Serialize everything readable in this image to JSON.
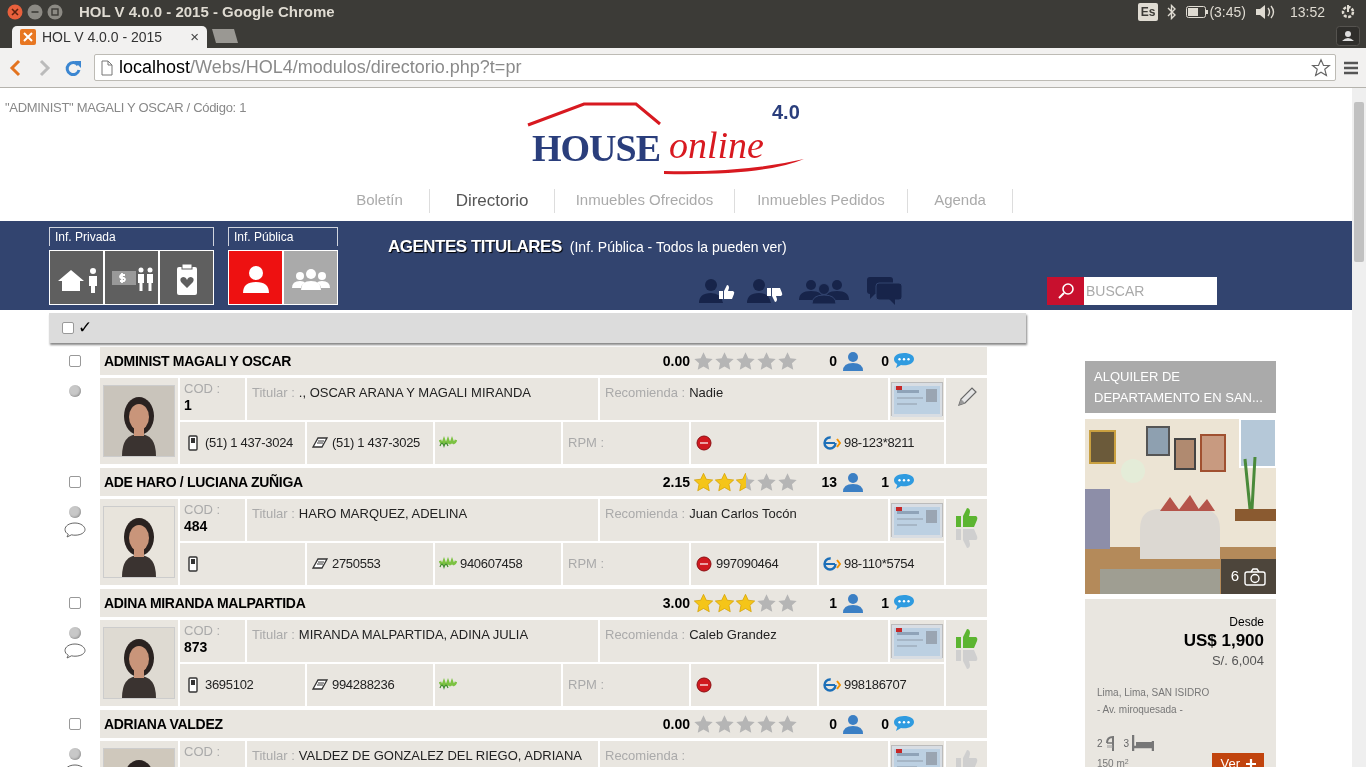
{
  "window": {
    "title": "HOL V 4.0.0 - 2015 - Google Chrome"
  },
  "tray": {
    "keyboard": "Es",
    "battery": "(3:45)",
    "clock": "13:52"
  },
  "tabs": [
    {
      "label": "HOL V 4.0.0 - 2015",
      "selected": true,
      "close": "×"
    }
  ],
  "address": "**localhost**/Webs/HOL4/modulos/directorio.php?t=pr",
  "user_info": "\"ADMINIST\" MAGALI Y OSCAR / Código: 1",
  "logo": {
    "name": "HOUSE",
    "suffix": "online",
    "version": "4.0"
  },
  "nav": [
    {
      "label": "Boletín",
      "selected": false
    },
    {
      "label": "Directorio",
      "selected": true
    },
    {
      "label": "Inmuebles Ofrecidos",
      "selected": false
    },
    {
      "label": "Inmuebles Pedidos",
      "selected": false
    },
    {
      "label": "Agenda",
      "selected": false
    }
  ],
  "groups": [
    {
      "label": "Inf. Privada",
      "buttons": [
        {
          "kind": "house-person",
          "selected": false
        },
        {
          "kind": "money-people",
          "selected": false
        },
        {
          "kind": "clipboard-heart",
          "selected": false
        }
      ]
    },
    {
      "label": "Inf. Pública",
      "buttons": [
        {
          "kind": "person",
          "selected": true
        },
        {
          "kind": "people",
          "selected": false
        }
      ]
    }
  ],
  "heading": {
    "title": "AGENTES TITULARES",
    "subtitle": "(Inf. Pública - Todos la pueden ver)"
  },
  "search": {
    "placeholder": "BUSCAR"
  },
  "select_all": {
    "checked": false,
    "mark": "✓"
  },
  "agents": [
    {
      "name": "ADMINIST MAGALI Y OSCAR",
      "checked": false,
      "has_note": false,
      "rating": "0.00",
      "stars": 0,
      "contacts": "0",
      "comments": "0",
      "cod_label": "COD :",
      "cod": "1",
      "titular_label": "Titular :",
      "titular": "., OSCAR ARANA Y MAGALI MIRANDA",
      "recomienda_label": "Recomienda :",
      "recomienda": "Nadie",
      "mobile": "(51) 1 437-3024",
      "phone": "(51) 1 437-3025",
      "rpm_label": "RPM :",
      "entel": "98-123*8211",
      "kind": "edit"
    },
    {
      "name": "ADE HARO / LUCIANA ZUÑIGA",
      "checked": false,
      "has_note": true,
      "rating": "2.15",
      "stars": 2.5,
      "contacts": "13",
      "comments": "1",
      "cod_label": "COD :",
      "cod": "484",
      "titular_label": "Titular :",
      "titular": "HARO MARQUEZ, ADELINA",
      "recomienda_label": "Recomienda :",
      "recomienda": "Juan Carlos Tocón",
      "phone": "2750553",
      "movistar": "940607458",
      "rpm_label": "RPM :",
      "claro": "997090464",
      "entel": "98-110*5754",
      "kind": "vote",
      "liked": true
    },
    {
      "name": "ADINA MIRANDA MALPARTIDA",
      "checked": false,
      "has_note": true,
      "rating": "3.00",
      "stars": 3,
      "contacts": "1",
      "comments": "1",
      "cod_label": "COD :",
      "cod": "873",
      "titular_label": "Titular :",
      "titular": "MIRANDA MALPARTIDA, ADINA JULIA",
      "recomienda_label": "Recomienda :",
      "recomienda": "Caleb Grandez",
      "mobile": "3695102",
      "phone": "994288236",
      "rpm_label": "RPM :",
      "entel": "998186707",
      "kind": "vote",
      "liked": true
    },
    {
      "name": "ADRIANA VALDEZ",
      "checked": false,
      "has_note": true,
      "rating": "0.00",
      "stars": 0,
      "contacts": "0",
      "comments": "0",
      "cod_label": "COD :",
      "titular_label": "Titular :",
      "titular": "VALDEZ DE GONZALEZ DEL RIEGO, ADRIANA",
      "recomienda_label": "Recomienda :",
      "kind": "vote",
      "liked": false
    }
  ],
  "listing": {
    "title": "ALQUILER DE DEPARTAMENTO EN SAN...",
    "photos": "6",
    "from_label": "Desde",
    "price": "US$ 1,900",
    "price_local": "S/. 6,004",
    "location": "Lima, Lima, SAN ISIDRO",
    "street": "- Av. miroquesada -",
    "baths": "2",
    "beds": "3",
    "area": "150 m$^{2}$",
    "button": "Ver"
  }
}
